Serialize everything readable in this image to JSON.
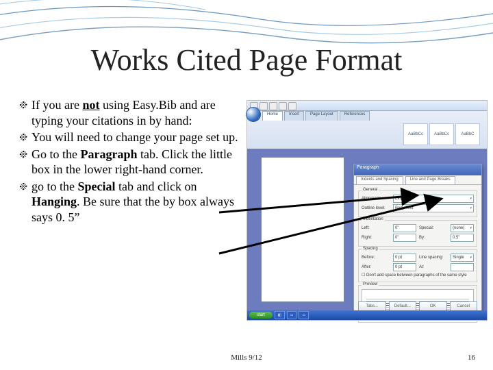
{
  "title": "Works Cited Page Format",
  "bullets": [
    {
      "pre": "If you are ",
      "u_bold": "not",
      "post": " using Easy.Bib and are typing your citations in by hand:"
    },
    {
      "plain": "You will need to change your page set up."
    },
    {
      "pre": "Go to the ",
      "bold1": "Paragraph",
      "post1": " tab. Click the little box in the lower right-hand corner."
    },
    {
      "pre": "go to the ",
      "bold1": "Special",
      "mid": " tab and click on ",
      "bold2": "Hanging",
      "post2": ". Be sure that the by box always says 0. 5”"
    }
  ],
  "footer_center": "Mills 9/12",
  "footer_right": "16",
  "word": {
    "tabs": [
      "Home",
      "Insert",
      "Page Layout",
      "References"
    ],
    "styles": [
      "AaBbCc",
      "AaBbCc",
      "AaBbC"
    ],
    "dialog_title": "Paragraph",
    "dlg_tab1": "Indents and Spacing",
    "dlg_tab2": "Line and Page Breaks",
    "general": "General",
    "alignment_lbl": "Alignment:",
    "alignment_val": "Left",
    "outline_lbl": "Outline level:",
    "outline_val": "Body Text",
    "indent": "Indentation",
    "left_lbl": "Left:",
    "right_lbl": "Right:",
    "zero": "0\"",
    "special_lbl": "Special:",
    "special_val": "(none)",
    "by_lbl": "By:",
    "by_val": "0.5\"",
    "spacing": "Spacing",
    "before_lbl": "Before:",
    "after_lbl": "After:",
    "pt0": "0 pt",
    "linesp_lbl": "Line spacing:",
    "linesp_val": "Single",
    "at_lbl": "At:",
    "chk": "Don't add space between paragraphs of the same style",
    "preview": "Preview",
    "btn_tabs": "Tabs...",
    "btn_default": "Default...",
    "btn_ok": "OK",
    "btn_cancel": "Cancel",
    "start": "start"
  }
}
